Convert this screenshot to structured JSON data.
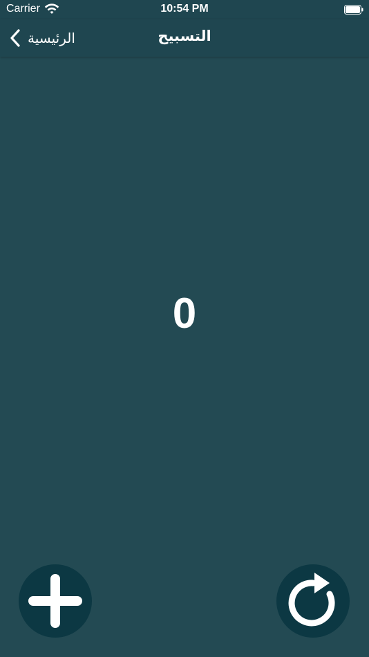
{
  "status_bar": {
    "carrier": "Carrier",
    "time": "10:54 PM",
    "wifi_icon": "wifi-icon",
    "battery_icon": "battery-icon"
  },
  "nav_bar": {
    "back_label": "الرئيسية",
    "back_icon": "chevron-left-icon",
    "title": "التسبيح"
  },
  "counter": {
    "value": "0"
  },
  "actions": {
    "add_icon": "plus-icon",
    "reset_icon": "refresh-icon"
  },
  "colors": {
    "background": "#234a53",
    "bar": "#1f4650",
    "button": "#0c3843",
    "text": "#ffffff"
  }
}
